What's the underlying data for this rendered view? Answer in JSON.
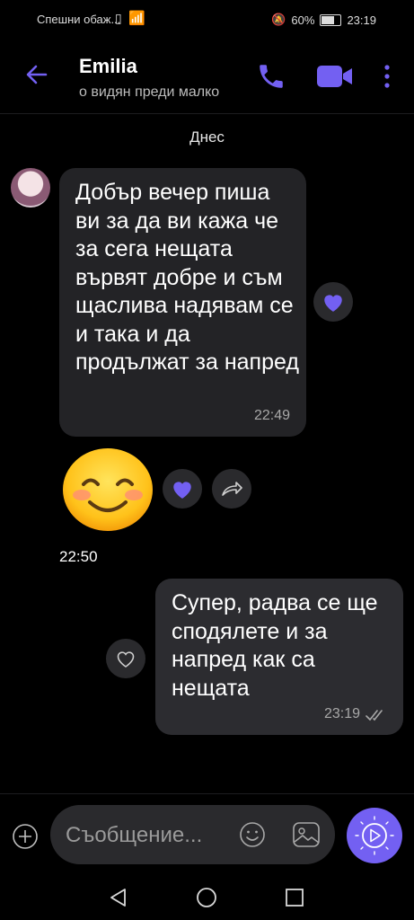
{
  "status": {
    "left_text": "Спешни обаж...",
    "battery": "60%",
    "time": "23:19"
  },
  "header": {
    "name": "Emilia",
    "subtitle": "о видян преди малко",
    "icons": [
      "arrow-left-icon",
      "phone-icon",
      "video-call-icon",
      "more-vertical-icon"
    ],
    "accent": "#7360f2"
  },
  "chat": {
    "date_separator": "Днес",
    "incoming": {
      "text": "Добър вечер пиша ви за да ви кажа че за сега нещата вървят добре и съм щаслива надявам се и така и да продължат за напред",
      "time": "22:49",
      "reaction": "heart-icon"
    },
    "sticker": {
      "emoji": "smiling-blushing-face",
      "time": "22:50"
    },
    "outgoing": {
      "text": "Супер, радва се ще сподялете и за напред как са нещата",
      "time": "23:19",
      "status": "double-check-icon"
    }
  },
  "composer": {
    "placeholder": "Съобщение...",
    "icons": [
      "plus-icon",
      "smile-icon",
      "gallery-icon",
      "send-icon"
    ]
  },
  "navigation": [
    "back-triangle-icon",
    "home-circle-icon",
    "recents-square-icon"
  ]
}
